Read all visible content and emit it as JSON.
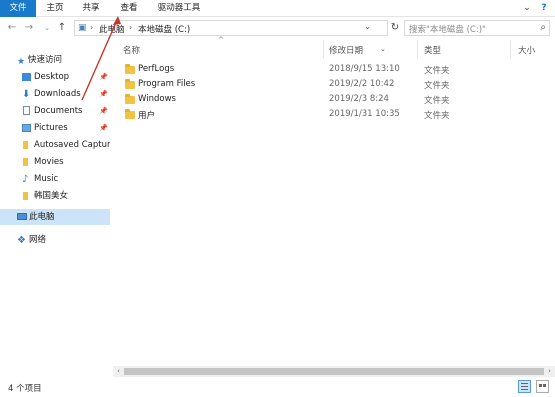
{
  "ribbon": {
    "tabs": [
      {
        "label": "文件",
        "active": true
      },
      {
        "label": "主页"
      },
      {
        "label": "共享"
      },
      {
        "label": "查看"
      },
      {
        "label": "驱动器工具"
      }
    ]
  },
  "address": {
    "crumbs": [
      "此电脑",
      "本地磁盘 (C:)"
    ],
    "search_placeholder": "搜索\"本地磁盘 (C:)\""
  },
  "sidebar": {
    "items": [
      {
        "label": "快速访问",
        "icon": "star-icon"
      },
      {
        "label": "Desktop",
        "icon": "desktop-icon",
        "pinned": true
      },
      {
        "label": "Downloads",
        "icon": "download-icon",
        "pinned": true
      },
      {
        "label": "Documents",
        "icon": "document-icon",
        "pinned": true
      },
      {
        "label": "Pictures",
        "icon": "pictures-icon",
        "pinned": true
      },
      {
        "label": "Autosaved Captures",
        "icon": "folder-icon"
      },
      {
        "label": "Movies",
        "icon": "folder-icon"
      },
      {
        "label": "Music",
        "icon": "music-icon"
      },
      {
        "label": "韩国美女",
        "icon": "folder-icon"
      },
      {
        "label": "此电脑",
        "icon": "computer-icon",
        "selected": true
      },
      {
        "label": "网络",
        "icon": "network-icon"
      }
    ]
  },
  "columns": {
    "name": "名称",
    "date": "修改日期",
    "type": "类型",
    "size": "大小"
  },
  "files": [
    {
      "name": "PerfLogs",
      "date": "2018/9/15 13:10",
      "type": "文件夹"
    },
    {
      "name": "Program Files",
      "date": "2019/2/2 10:42",
      "type": "文件夹"
    },
    {
      "name": "Windows",
      "date": "2019/2/3 8:24",
      "type": "文件夹"
    },
    {
      "name": "用户",
      "date": "2019/1/31 10:35",
      "type": "文件夹"
    }
  ],
  "status": {
    "item_count": "4 个项目"
  },
  "colors": {
    "accent": "#1979ca",
    "selection": "#cce4f7",
    "folder": "#f0c443",
    "annotation": "#c0392b"
  }
}
